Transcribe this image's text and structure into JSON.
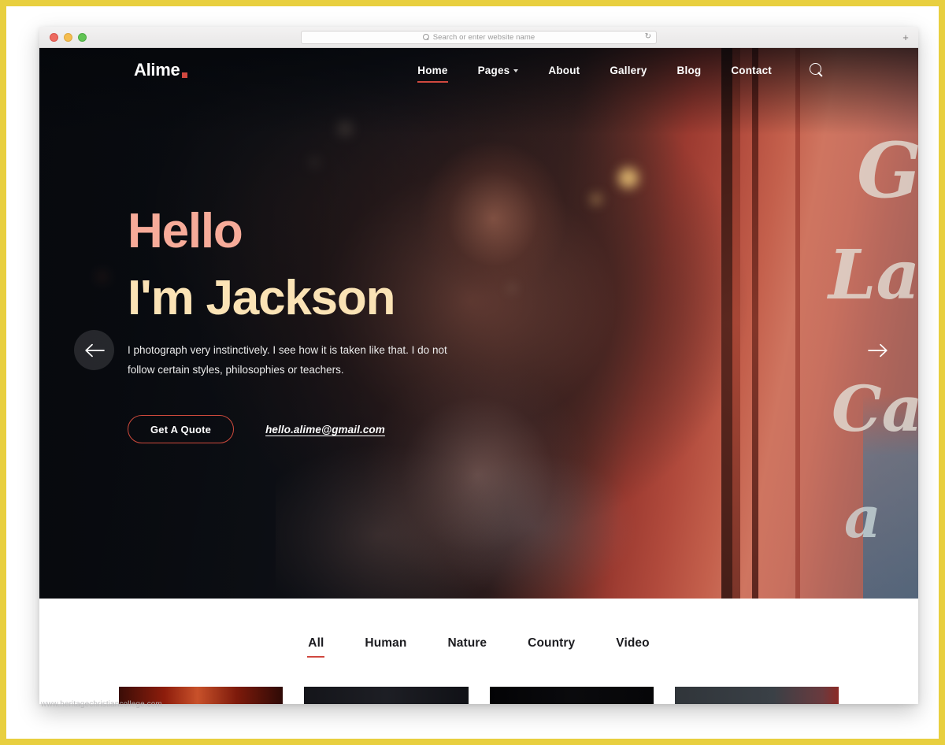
{
  "browser": {
    "window_controls": [
      "close",
      "minimize",
      "maximize"
    ],
    "address_placeholder": "Search or enter website name",
    "address_value": "",
    "reload_icon": "reload-icon",
    "search_icon": "search-icon",
    "newtab_label": "+"
  },
  "site": {
    "logo_text": "Alime",
    "logo_accent_color": "#d0483f",
    "nav": [
      {
        "label": "Home",
        "active": true,
        "has_dropdown": false
      },
      {
        "label": "Pages",
        "active": false,
        "has_dropdown": true
      },
      {
        "label": "About",
        "active": false,
        "has_dropdown": false
      },
      {
        "label": "Gallery",
        "active": false,
        "has_dropdown": false
      },
      {
        "label": "Blog",
        "active": false,
        "has_dropdown": false
      },
      {
        "label": "Contact",
        "active": false,
        "has_dropdown": false
      }
    ],
    "nav_search_icon": "search-icon"
  },
  "hero": {
    "greeting": "Hello",
    "greeting_color": "#f7ab99",
    "name": "I'm Jackson",
    "name_color": "#fbe3b5",
    "description": "I photograph very instinctively. I see how it is taken like that. I do not follow certain styles, philosophies or teachers.",
    "cta_button": "Get A Quote",
    "cta_border_color": "#cf4a3c",
    "email": "hello.alime@gmail.com",
    "prev_icon": "arrow-left-icon",
    "next_icon": "arrow-right-icon",
    "graffiti": [
      "G",
      "La",
      "Ca",
      "a"
    ]
  },
  "gallery": {
    "filters": [
      {
        "label": "All",
        "active": true
      },
      {
        "label": "Human",
        "active": false
      },
      {
        "label": "Nature",
        "active": false
      },
      {
        "label": "Country",
        "active": false
      },
      {
        "label": "Video",
        "active": false
      }
    ],
    "active_underline_color": "#d0483f",
    "thumbnails": [
      "thumb-1",
      "thumb-2",
      "thumb-3",
      "thumb-4"
    ]
  },
  "watermark": "www.heritagechristiancollege.com",
  "frame": {
    "border_color": "#e8cf3f"
  }
}
